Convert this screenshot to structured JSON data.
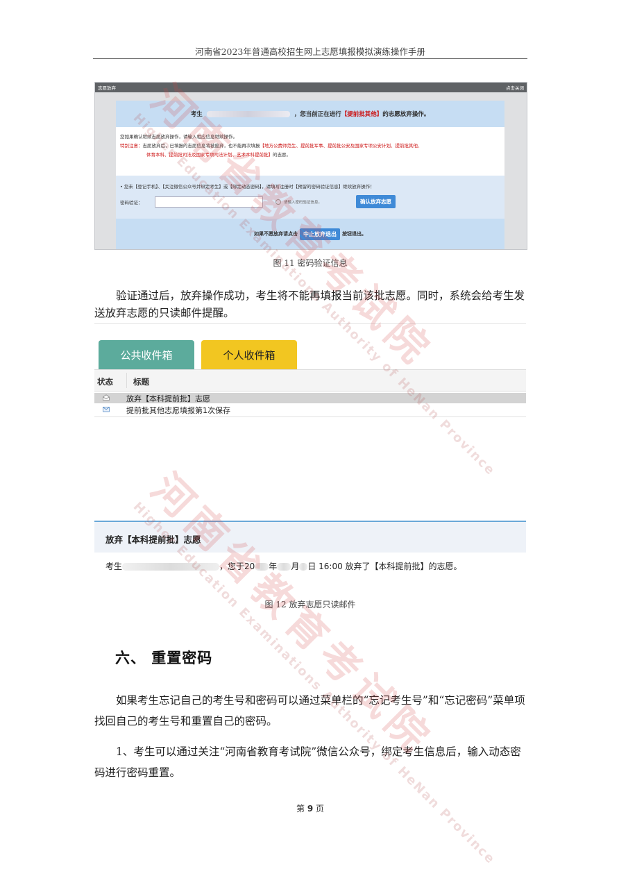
{
  "header": {
    "running_title": "河南省2023年普通高校招生网上志愿填报模拟演练操作手册"
  },
  "figure11": {
    "dialog_title": "志愿放弃",
    "close_label": "点击关闭",
    "notice_prefix": "考生",
    "notice_middle": "，您当前正在进行",
    "notice_highlight": "【提前批其他】",
    "notice_suffix": "的志愿放弃操作。",
    "confirm_line": "您如果确认继续志愿放弃操作，请输入相应信息继续操作。",
    "special_label": "特别注意：",
    "special_text_1": "志愿放弃后，已填报的志愿信息将被废弃，也不能再次填报",
    "special_red_1": "【地方公费师范生、提前批军事、提前批公安及国家专项公安计划、提前批其他、",
    "special_red_2": "体育本科、提前批司法及国家专项司法计划、艺术本科提前批】",
    "special_tail": "的志愿。",
    "bind_notice": "• 您未【登记手机】、【关注微信公众号并绑定考生】或【绑定动态密码】，请填写注册时【预留的密码验证信息】继续放弃操作！",
    "verify_label": "密码验证：",
    "verify_value": "",
    "verify_hint": "请输入密码验证信息。",
    "confirm_button": "确认放弃志愿",
    "abort_prefix": "如果不愿放弃请点击",
    "abort_button": "中止放弃退出",
    "abort_suffix": "按钮退出。",
    "caption": "图 11 密码验证信息"
  },
  "paragraph1": "验证通过后，放弃操作成功，考生将不能再填报当前该批志愿。同时，系统会给考生发送放弃志愿的只读邮件提醒。",
  "inbox": {
    "tab_public": "公共收件箱",
    "tab_personal": "个人收件箱",
    "col_status": "状态",
    "col_title": "标题",
    "rows": [
      {
        "status_icon": "opened-envelope-icon",
        "title": "放弃【本科提前批】志愿"
      },
      {
        "status_icon": "envelope-icon",
        "title": "提前批其他志愿填报第1次保存"
      }
    ]
  },
  "mailview": {
    "subject": "放弃【本科提前批】志愿",
    "body_prefix": "考生",
    "body_part1": "，您于20",
    "body_part2": "年",
    "body_part3": "月",
    "body_part4": "日 16:00 放弃了【本科提前批】的志愿。"
  },
  "figure12_caption": "图 12 放弃志愿只读邮件",
  "section6": {
    "title": "六、  重置密码",
    "para1": "如果考生忘记自己的考生号和密码可以通过菜单栏的“忘记考生号”和“忘记密码”菜单项找回自己的考生号和重置自己的密码。",
    "para2": "1、考生可以通过关注“河南省教育考试院”微信公众号，绑定考生信息后，输入动态密码进行密码重置。"
  },
  "footer": {
    "prefix": "第",
    "page": "9",
    "suffix": "页"
  },
  "watermark": {
    "cn": "河南省教育考试院",
    "en": "Higher Education Examinations Authority of HeNan Province"
  },
  "colors": {
    "accent_blue": "#3f8ad7",
    "tab_public": "#5cab9c",
    "tab_personal": "#f2c621",
    "warning_red": "#cc1111"
  }
}
